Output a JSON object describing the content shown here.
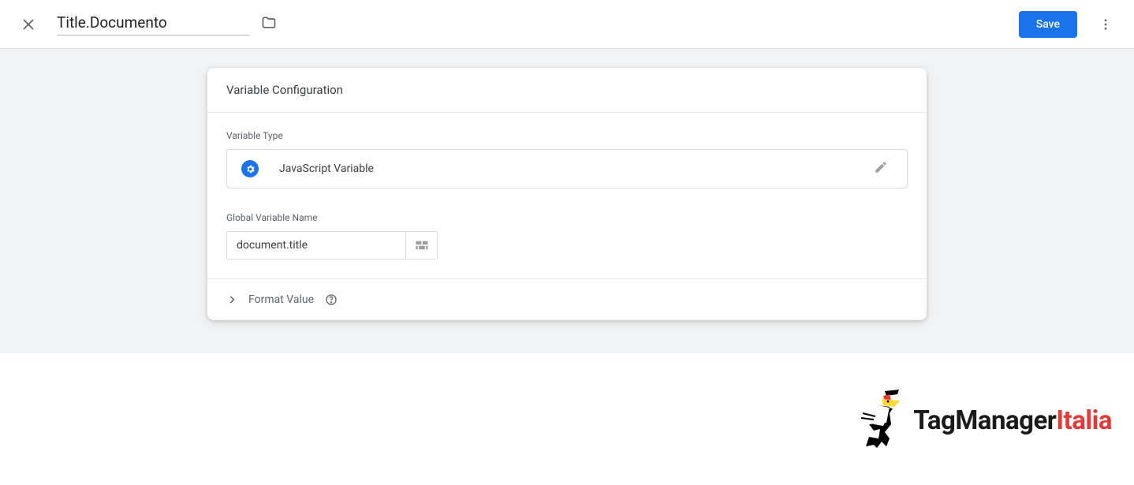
{
  "header": {
    "title": "Title.Documento",
    "save_label": "Save"
  },
  "card": {
    "title": "Variable Configuration",
    "type_label": "Variable Type",
    "type_name": "JavaScript Variable",
    "global_var_label": "Global Variable Name",
    "global_var_value": "document.title",
    "format_value_label": "Format Value"
  },
  "footer": {
    "logo_tag": "TagManager",
    "logo_italia": "Italia"
  }
}
